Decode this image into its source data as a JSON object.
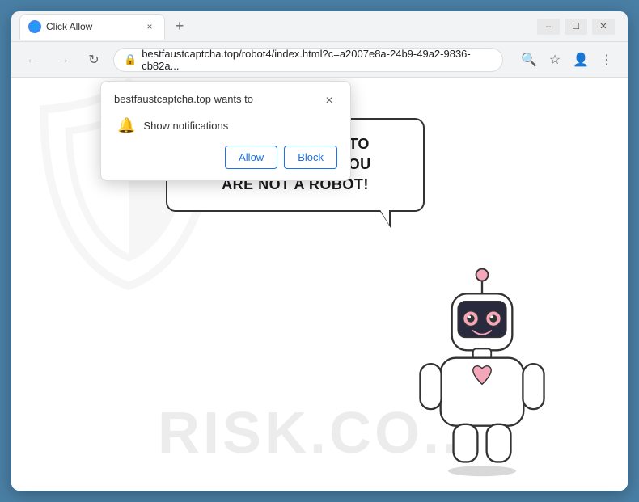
{
  "browser": {
    "title_bar": {
      "tab_title": "Click Allow",
      "tab_favicon": "🌐",
      "new_tab_symbol": "+"
    },
    "controls": {
      "minimize": "–",
      "maximize": "☐",
      "close": "✕"
    },
    "address_bar": {
      "url": "bestfaustcaptcha.top/robot4/index.html?c=a2007e8a-24b9-49a2-9836-cb82a...",
      "back": "←",
      "forward": "→",
      "reload": "↻"
    }
  },
  "popup": {
    "title": "bestfaustcaptcha.top wants to",
    "close_symbol": "×",
    "permission_label": "Show notifications",
    "allow_label": "Allow",
    "block_label": "Block"
  },
  "page": {
    "bubble_line1": "CLICK «ALLOW» TO CONFIRM THAT YOU",
    "bubble_line2": "ARE NOT A ROBOT!",
    "watermark": "RISK.CO..."
  }
}
